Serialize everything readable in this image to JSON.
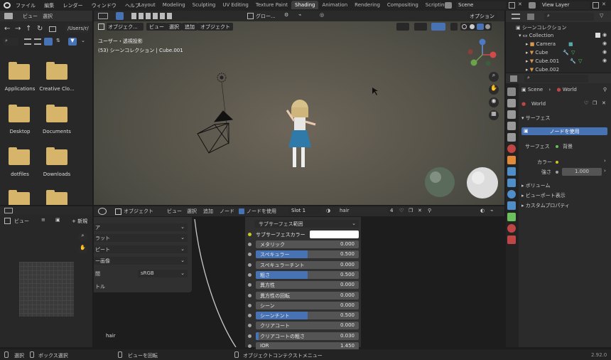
{
  "topbar": {
    "menus": [
      "ファイル",
      "編集",
      "レンダー",
      "ウィンドウ",
      "ヘルプ"
    ],
    "workspaces": [
      "Layout",
      "Modeling",
      "Sculpting",
      "UV Editing",
      "Texture Paint",
      "Shading",
      "Animation",
      "Rendering",
      "Compositing",
      "Scripting"
    ],
    "active_workspace": "Shading",
    "scene": "Scene",
    "view_layer": "View Layer"
  },
  "filebrowser": {
    "header_menus": [
      "ビュー",
      "選択"
    ],
    "path": "/Users/r/",
    "items": [
      "Applications",
      "Creative Clo...",
      "Desktop",
      "Documents",
      "dotfiles",
      "Downloads",
      "",
      ""
    ]
  },
  "viewport": {
    "mode": "オブジェク...",
    "menus": [
      "ビュー",
      "選択",
      "追加",
      "オブジェクト"
    ],
    "transform": "グロー...",
    "options": "オプション",
    "info_line1": "ユーザー・透視投影",
    "info_line2": "(53) シーンコレクション | Cube.001"
  },
  "image_editor": {
    "view_menu": "ビュー",
    "new_button": "新規"
  },
  "node_editor": {
    "mode": "オブジェクト",
    "menus": [
      "ビュー",
      "選択",
      "追加",
      "ノード"
    ],
    "use_nodes": "ノードを使用",
    "slot": "Slot 1",
    "material": "hair",
    "user_count": "4",
    "node_label": "hair",
    "texture_panel": [
      "ア",
      "ラット",
      "ピート",
      "ー画像"
    ],
    "color_space_label": "間",
    "color_space": "sRGB",
    "panel_bottom": "トル",
    "subsurface_method": "サブサーフェス範囲",
    "subsurface_color": "サブサーフェスカラー",
    "properties": [
      {
        "label": "メタリック",
        "value": "0.000",
        "fill": 0
      },
      {
        "label": "スペキュラー",
        "value": "0.500",
        "fill": 0.5
      },
      {
        "label": "スペキュラーチント",
        "value": "0.000",
        "fill": 0
      },
      {
        "label": "粗さ",
        "value": "0.500",
        "fill": 0.5
      },
      {
        "label": "異方性",
        "value": "0.000",
        "fill": 0
      },
      {
        "label": "異方性の回転",
        "value": "0.000",
        "fill": 0
      },
      {
        "label": "シーン",
        "value": "0.000",
        "fill": 0
      },
      {
        "label": "シーンチント",
        "value": "0.500",
        "fill": 0.5
      },
      {
        "label": "クリアコート",
        "value": "0.000",
        "fill": 0
      },
      {
        "label": "クリアコートの粗さ",
        "value": "0.030",
        "fill": 0.03
      },
      {
        "label": "IOR",
        "value": "1.450",
        "fill": 0
      }
    ]
  },
  "outliner": {
    "title": "シーンコレクション",
    "items": [
      "Collection",
      "Camera",
      "Cube",
      "Cube.001",
      "Cube.002"
    ]
  },
  "properties": {
    "tabs": [
      "Scene",
      "World"
    ],
    "world_name": "World",
    "surface_panel": "サーフェス",
    "use_nodes_button": "ノードを使用",
    "surface_label": "サーフェス",
    "surface_value": "背景",
    "color_label": "カラー",
    "strength_label": "強さ",
    "strength_value": "1.000",
    "panels": [
      "ボリューム",
      "ビューポート表示",
      "カスタムプロパティ"
    ]
  },
  "statusbar": {
    "select": "選択",
    "box_select": "ボックス選択",
    "rotate_view": "ビューを回転",
    "context_menu": "オブジェクトコンテクストメニュー",
    "version": "2.92.0"
  },
  "colors": {
    "accent": "#4772b3",
    "active_tab": "#3f3f3f",
    "folder": "#d6b56a",
    "panel_bg": "#303030"
  }
}
